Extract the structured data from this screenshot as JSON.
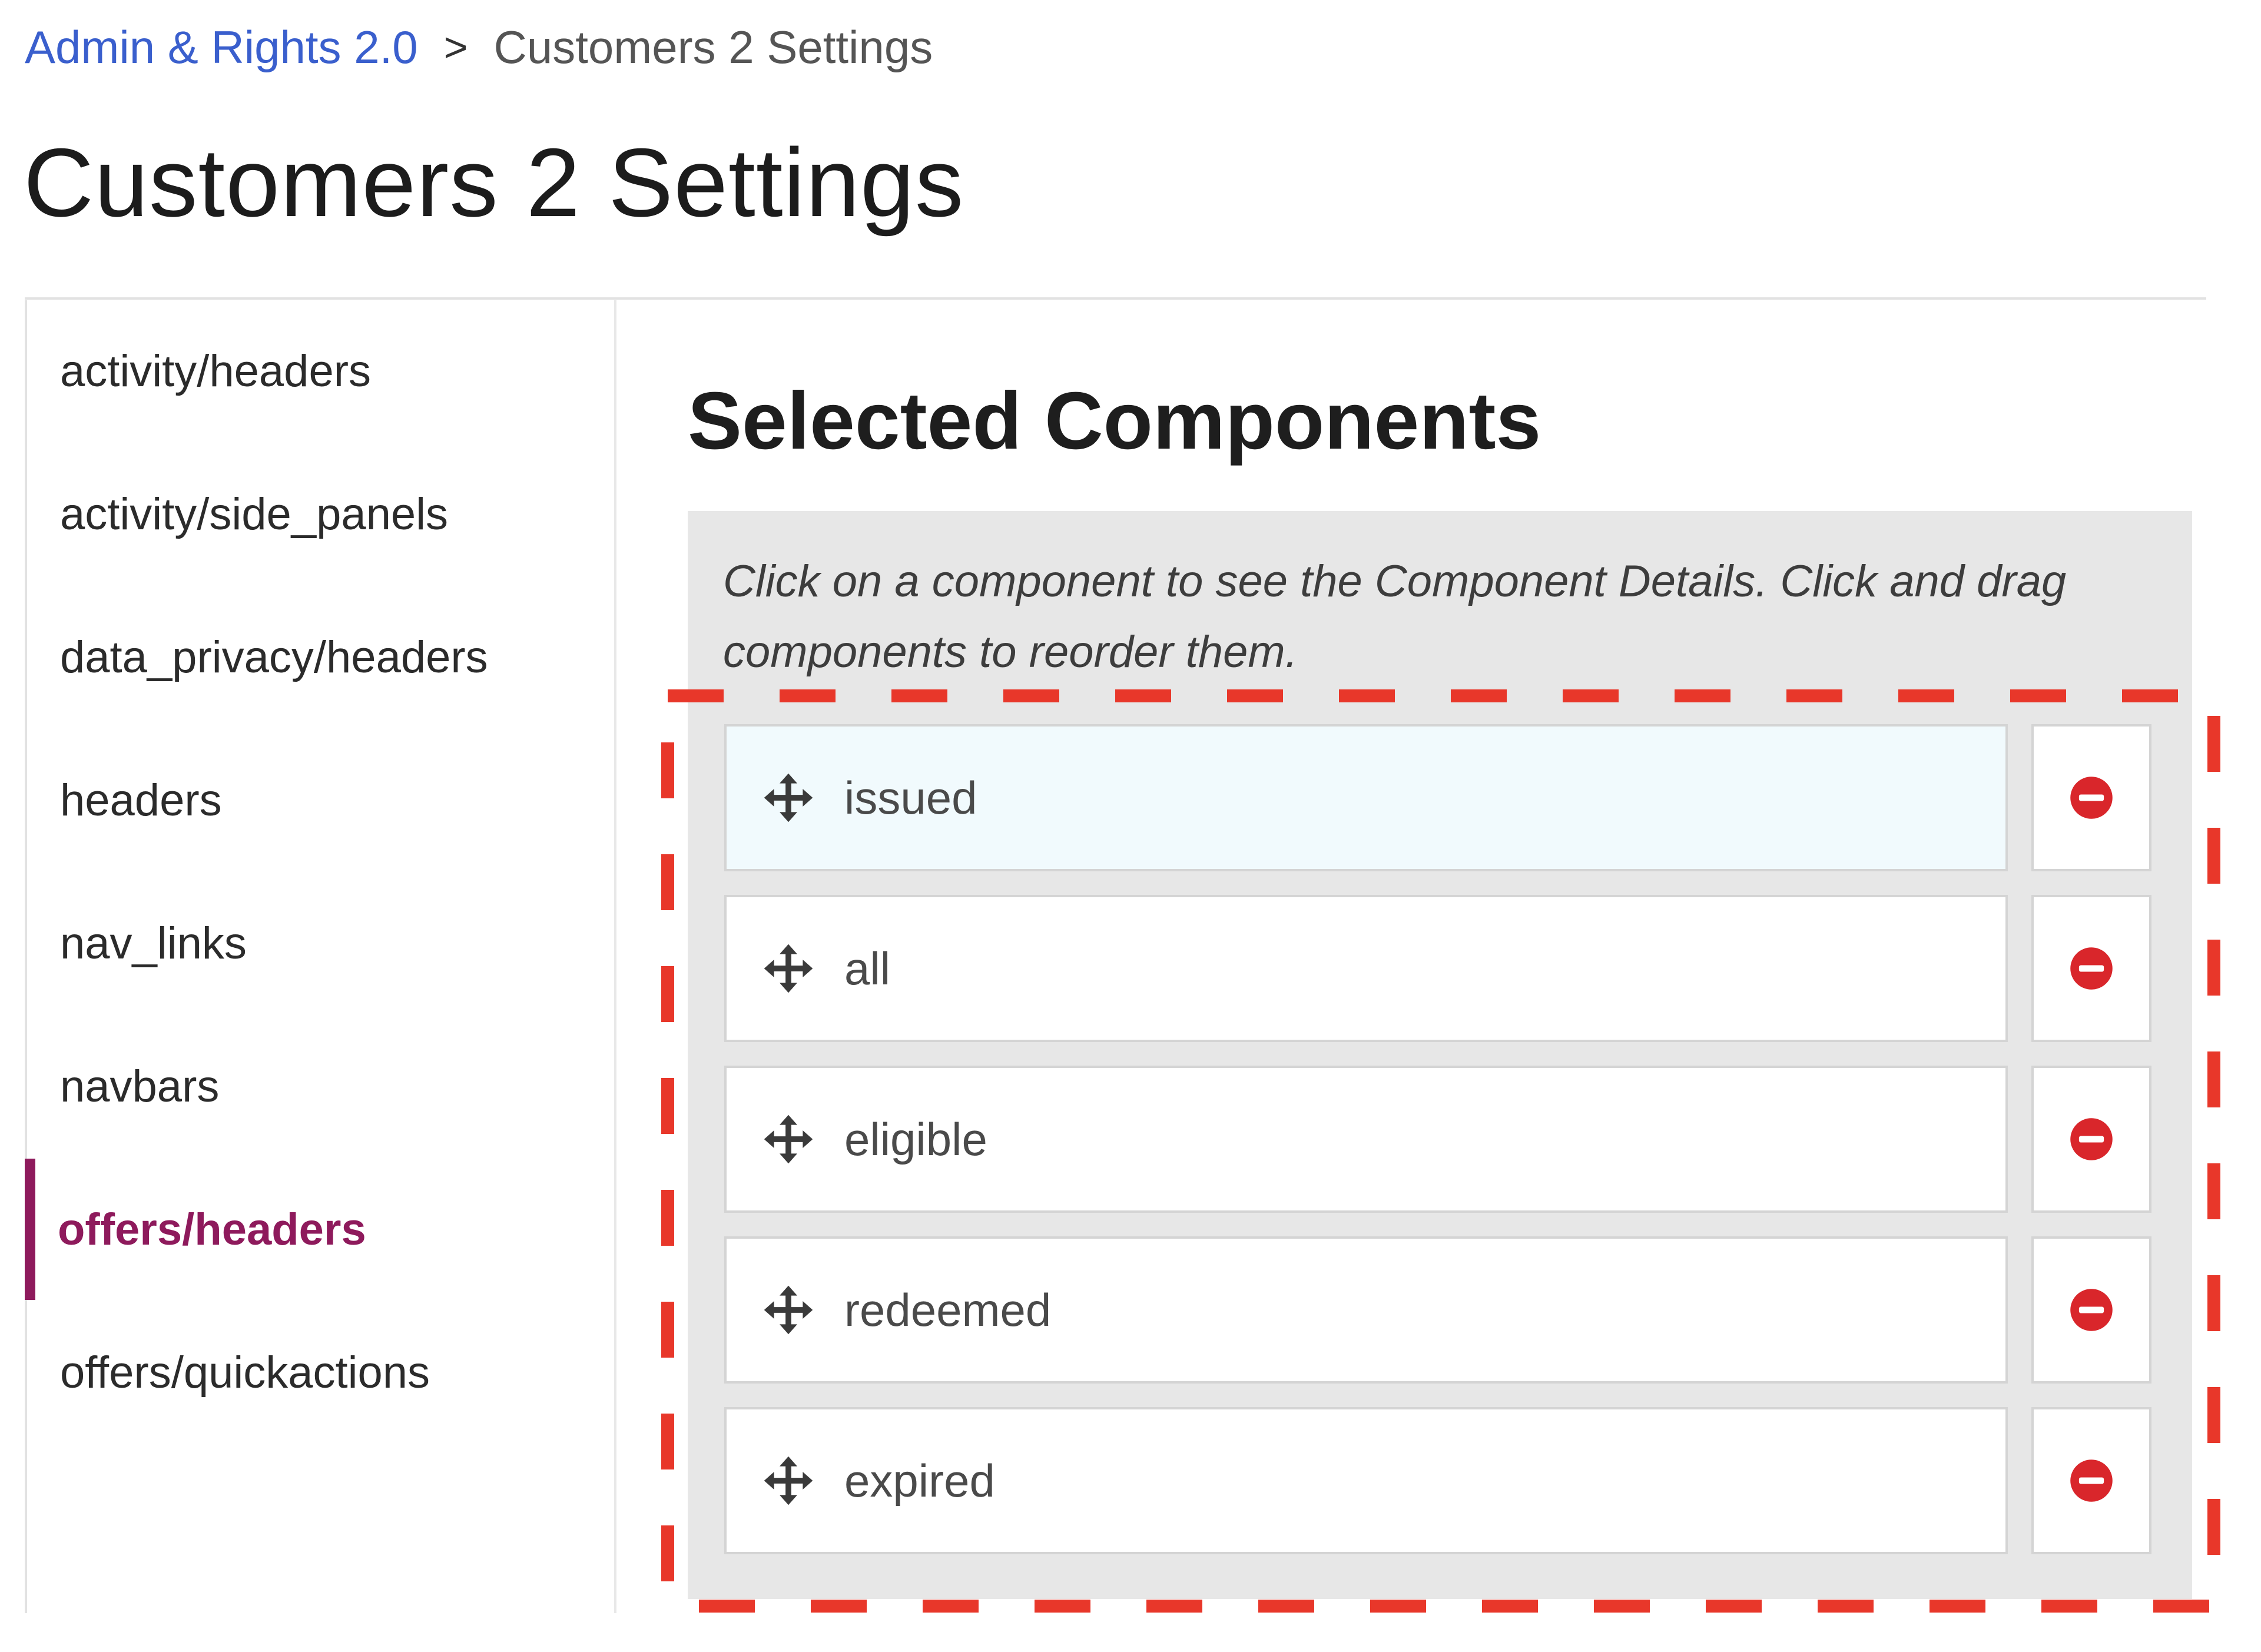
{
  "breadcrumb": {
    "parent": "Admin & Rights 2.0",
    "separator": ">",
    "current": "Customers 2 Settings"
  },
  "page": {
    "title": "Customers 2 Settings"
  },
  "sidebar": {
    "items": [
      {
        "label": "activity/headers",
        "active": false
      },
      {
        "label": "activity/side_panels",
        "active": false
      },
      {
        "label": "data_privacy/headers",
        "active": false
      },
      {
        "label": "headers",
        "active": false
      },
      {
        "label": "nav_links",
        "active": false
      },
      {
        "label": "navbars",
        "active": false
      },
      {
        "label": "offers/headers",
        "active": true
      },
      {
        "label": "offers/quickactions",
        "active": false
      }
    ]
  },
  "main": {
    "section_title": "Selected Components",
    "hint": "Click on a component to see the Component Details. Click and drag components to reorder them.",
    "components": [
      {
        "label": "issued",
        "selected": true,
        "drag_icon": "move-arrows-icon",
        "remove_icon": "minus-circle-icon"
      },
      {
        "label": "all",
        "selected": false,
        "drag_icon": "move-arrows-icon",
        "remove_icon": "minus-circle-icon"
      },
      {
        "label": "eligible",
        "selected": false,
        "drag_icon": "move-arrows-icon",
        "remove_icon": "minus-circle-icon"
      },
      {
        "label": "redeemed",
        "selected": false,
        "drag_icon": "move-arrows-icon",
        "remove_icon": "minus-circle-icon"
      },
      {
        "label": "expired",
        "selected": false,
        "drag_icon": "move-arrows-icon",
        "remove_icon": "minus-circle-icon"
      }
    ]
  },
  "colors": {
    "link": "#3a5fcd",
    "active_accent": "#8e1a5c",
    "remove_red": "#d9262b",
    "highlight_dash": "#e8372a",
    "selected_row_bg": "#f1fafd",
    "panel_bg": "#e7e7e7"
  }
}
